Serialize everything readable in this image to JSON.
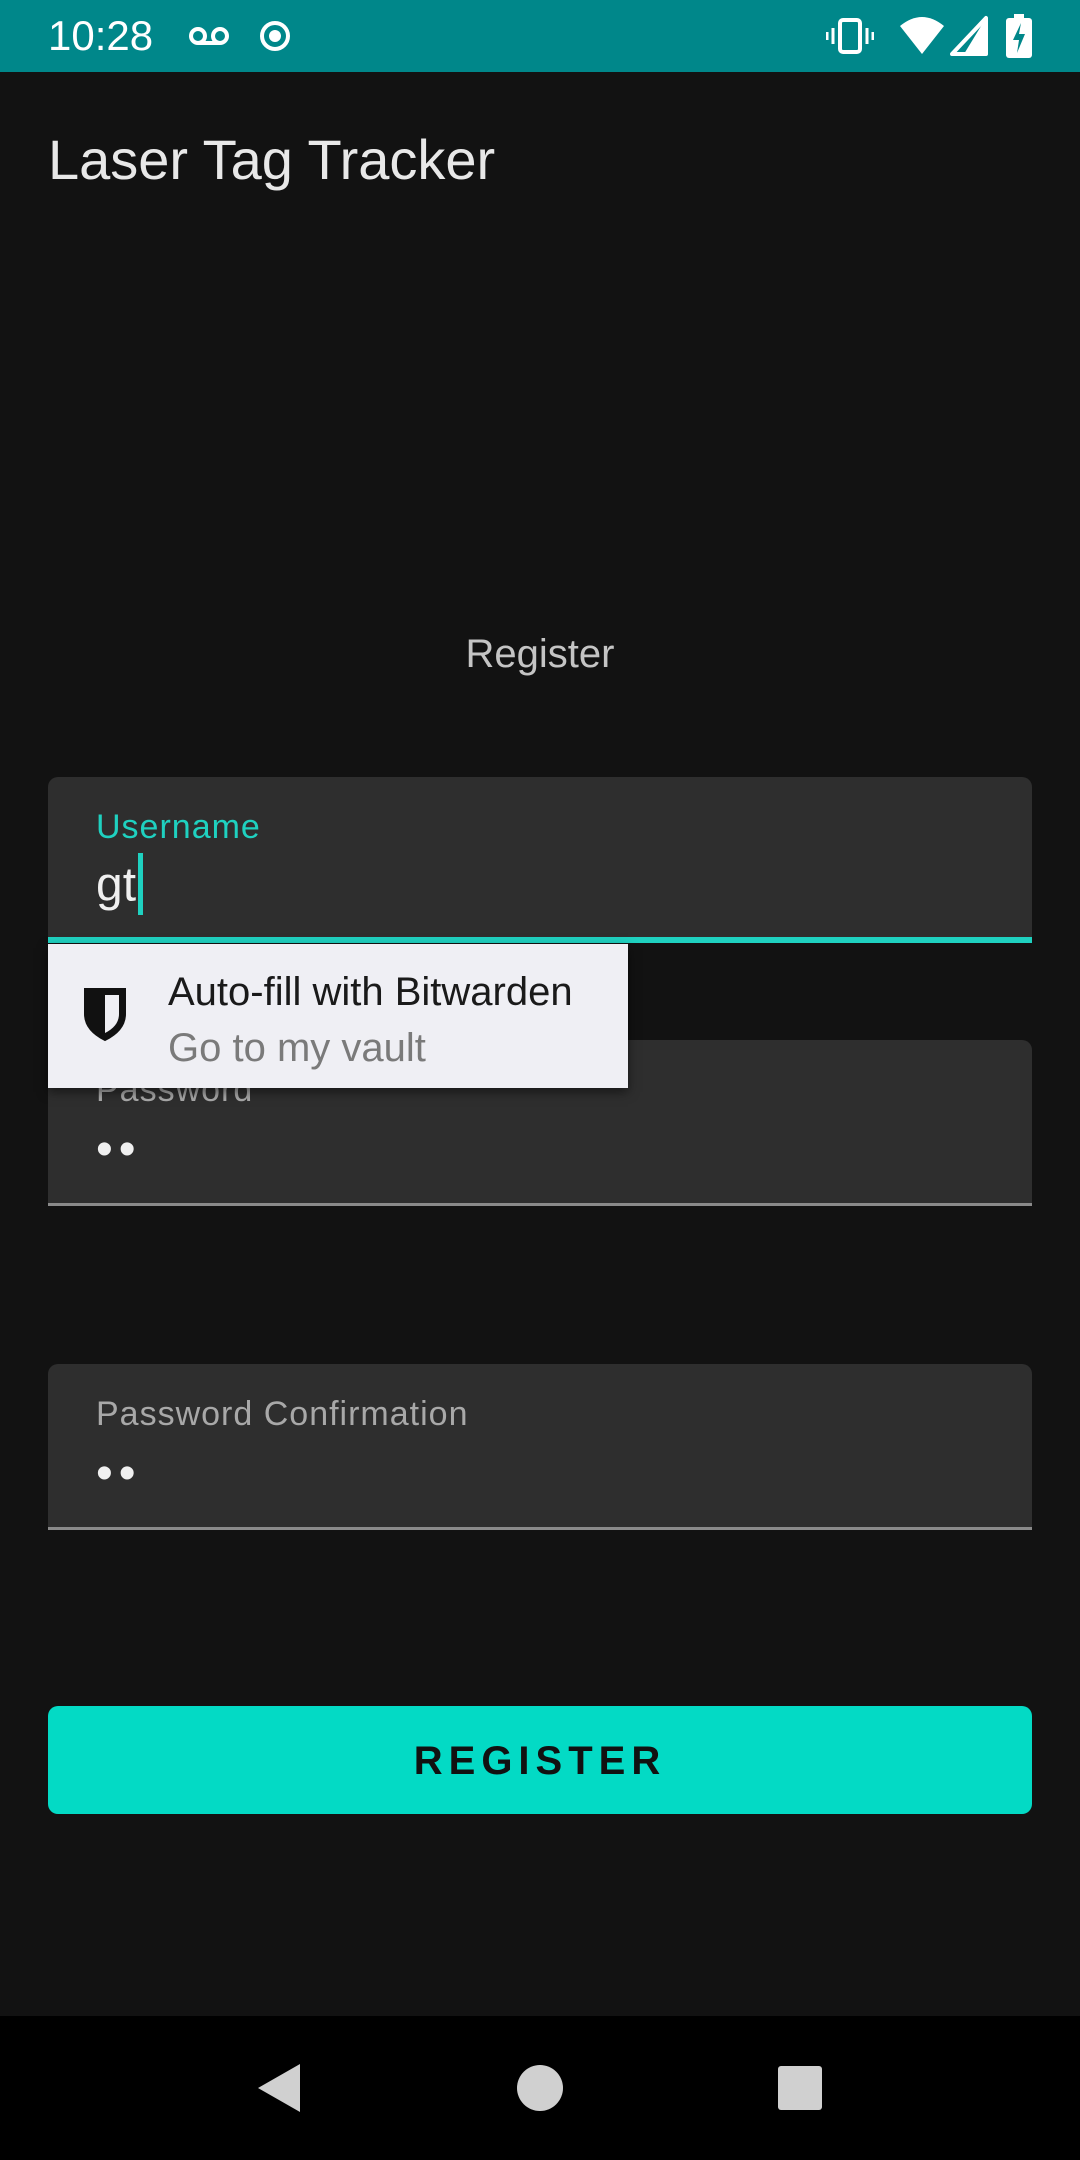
{
  "status_bar": {
    "time": "10:28",
    "left_icons": [
      "voicemail-icon",
      "record-icon"
    ],
    "right_icons": [
      "vibrate-icon",
      "wifi-icon",
      "cellular-signal-icon",
      "battery-charging-icon"
    ],
    "background_color": "#00878a"
  },
  "app": {
    "title": "Laser Tag Tracker"
  },
  "screen": {
    "heading": "Register"
  },
  "form": {
    "username": {
      "label": "Username",
      "value": "gt",
      "focused": true
    },
    "password": {
      "label": "Password",
      "value": "••"
    },
    "password_confirmation": {
      "label": "Password Confirmation",
      "value": "••"
    },
    "accent_color": "#1fd1c0"
  },
  "autofill": {
    "icon": "bitwarden-shield-icon",
    "title": "Auto-fill with Bitwarden",
    "subtitle": "Go to my vault"
  },
  "register_button": {
    "label": "REGISTER",
    "color": "#03dac5"
  },
  "nav_bar": {
    "buttons": [
      "back-icon",
      "home-icon",
      "recents-icon"
    ]
  }
}
